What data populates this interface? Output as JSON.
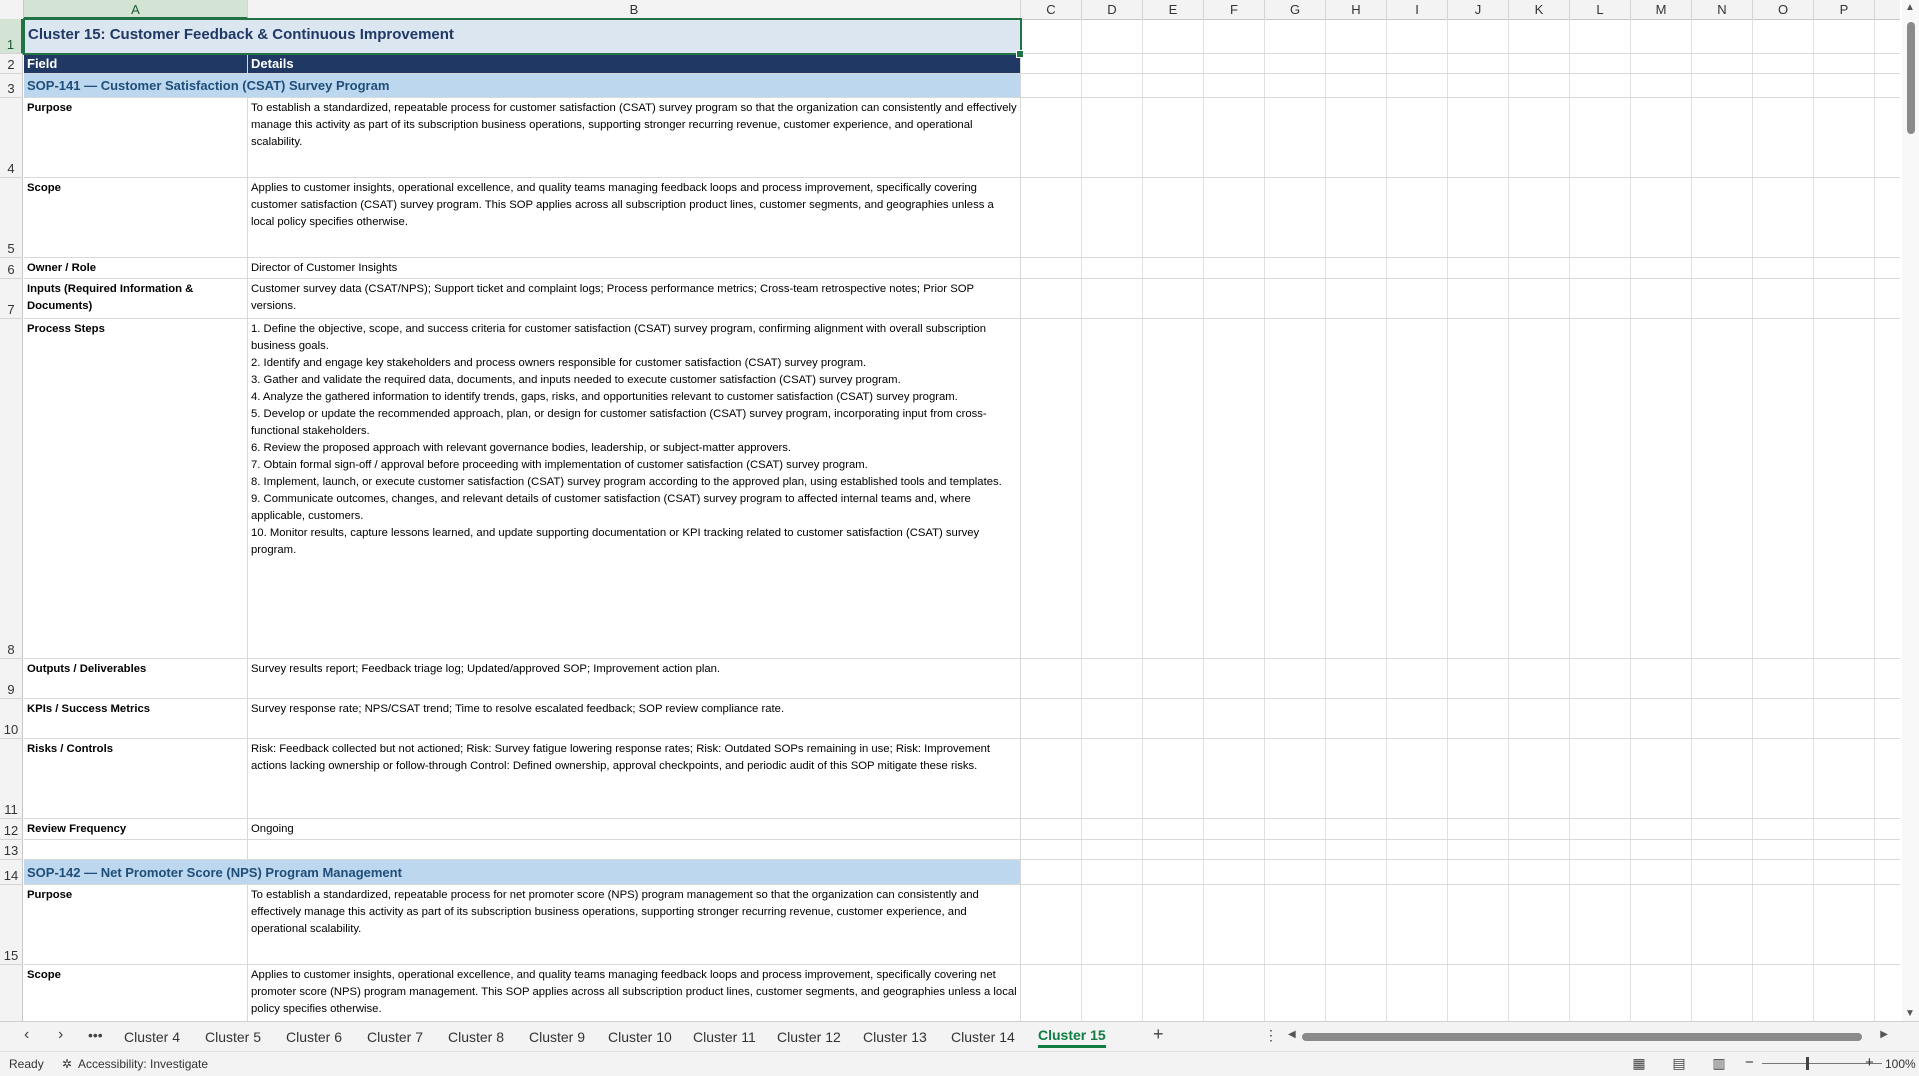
{
  "columns": [
    "A",
    "B",
    "C",
    "D",
    "E",
    "F",
    "G",
    "H",
    "I",
    "J",
    "K",
    "L",
    "M",
    "N",
    "O",
    "P"
  ],
  "title": "Cluster 15: Customer Feedback & Continuous Improvement",
  "header": {
    "field": "Field",
    "details": "Details"
  },
  "sop141": {
    "heading": "SOP-141 — Customer Satisfaction (CSAT) Survey Program",
    "purpose_label": "Purpose",
    "purpose": "To establish a standardized, repeatable process for customer satisfaction (CSAT) survey program so that the organization can consistently and effectively manage this activity as part of its subscription business operations, supporting stronger recurring revenue, customer experience, and operational scalability.",
    "scope_label": "Scope",
    "scope": "Applies to customer insights, operational excellence, and quality teams managing feedback loops and process improvement, specifically covering customer satisfaction (CSAT) survey program. This SOP applies across all subscription product lines, customer segments, and geographies unless a local policy specifies otherwise.",
    "owner_label": "Owner / Role",
    "owner": "Director of Customer Insights",
    "inputs_label": "Inputs (Required Information & Documents)",
    "inputs": "Customer survey data (CSAT/NPS); Support ticket and complaint logs; Process performance metrics; Cross-team retrospective notes; Prior SOP versions.",
    "steps_label": "Process Steps",
    "steps": [
      "1. Define the objective, scope, and success criteria for customer satisfaction (CSAT) survey program, confirming alignment with overall subscription business goals.",
      "2. Identify and engage key stakeholders and process owners responsible for customer satisfaction (CSAT) survey program.",
      "3. Gather and validate the required data, documents, and inputs needed to execute customer satisfaction (CSAT) survey program.",
      "4. Analyze the gathered information to identify trends, gaps, risks, and opportunities relevant to customer satisfaction (CSAT) survey program.",
      "5. Develop or update the recommended approach, plan, or design for customer satisfaction (CSAT) survey program, incorporating input from cross-functional stakeholders.",
      "6. Review the proposed approach with relevant governance bodies, leadership, or subject-matter approvers.",
      "7. Obtain formal sign-off / approval before proceeding with implementation of customer satisfaction (CSAT) survey program.",
      "8. Implement, launch, or execute customer satisfaction (CSAT) survey program according to the approved plan, using established tools and templates.",
      "9. Communicate outcomes, changes, and relevant details of customer satisfaction (CSAT) survey program to affected internal teams and, where applicable, customers.",
      "10. Monitor results, capture lessons learned, and update supporting documentation or KPI tracking related to customer satisfaction (CSAT) survey program."
    ],
    "outputs_label": "Outputs / Deliverables",
    "outputs": "Survey results report; Feedback triage log; Updated/approved SOP; Improvement action plan.",
    "kpis_label": "KPIs / Success Metrics",
    "kpis": "Survey response rate; NPS/CSAT trend; Time to resolve escalated feedback; SOP review compliance rate.",
    "risks_label": "Risks / Controls",
    "risks": "Risk: Feedback collected but not actioned; Risk: Survey fatigue lowering response rates; Risk: Outdated SOPs remaining in use; Risk: Improvement actions lacking ownership or follow-through Control: Defined ownership, approval checkpoints, and periodic audit of this SOP mitigate these risks.",
    "review_label": "Review Frequency",
    "review": "Ongoing"
  },
  "sop142": {
    "heading": "SOP-142 — Net Promoter Score (NPS) Program Management",
    "purpose_label": "Purpose",
    "purpose": "To establish a standardized, repeatable process for net promoter score (NPS) program management so that the organization can consistently and effectively manage this activity as part of its subscription business operations, supporting stronger recurring revenue, customer experience, and operational scalability.",
    "scope_label": "Scope",
    "scope": "Applies to customer insights, operational excellence, and quality teams managing feedback loops and process improvement, specifically covering net promoter score (NPS) program management. This SOP applies across all subscription product lines, customer segments, and geographies unless a local policy specifies otherwise."
  },
  "row_numbers": [
    "1",
    "2",
    "3",
    "4",
    "5",
    "6",
    "7",
    "8",
    "9",
    "10",
    "11",
    "12",
    "13",
    "14",
    "15"
  ],
  "tabs": [
    "Cluster 4",
    "Cluster 5",
    "Cluster 6",
    "Cluster 7",
    "Cluster 8",
    "Cluster 9",
    "Cluster 10",
    "Cluster 11",
    "Cluster 12",
    "Cluster 13",
    "Cluster 14",
    "Cluster 15"
  ],
  "active_tab": "Cluster 15",
  "status": {
    "ready": "Ready",
    "accessibility": "Accessibility: Investigate",
    "zoom": "100%"
  },
  "colors": {
    "title_bg": "#dce6f1",
    "header_bg": "#1f3864",
    "section_bg": "#bdd7ee",
    "accent": "#107c41"
  }
}
